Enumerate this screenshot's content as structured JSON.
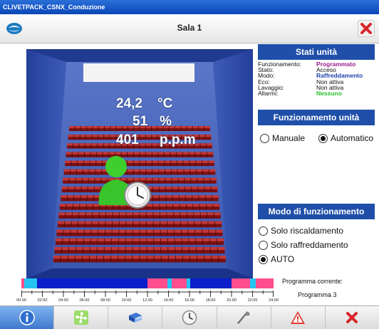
{
  "window": {
    "title": "CLIVETPACK_CSNX_Conduzione"
  },
  "header": {
    "title": "Sala 1"
  },
  "readouts": {
    "temperature": "24,2",
    "temperature_unit": "°C",
    "humidity": "51",
    "humidity_unit": "%",
    "co2": "401",
    "co2_unit": "p.p.m"
  },
  "stati": {
    "header": "Stati unità",
    "rows": [
      {
        "label": "Funzionamento:",
        "value": "Programmato",
        "color": "#9b1a8c"
      },
      {
        "label": "Stato:",
        "value": "Acceso",
        "color": "#111111"
      },
      {
        "label": "Modo:",
        "value": "Raffreddamento",
        "color": "#1b3ea8"
      },
      {
        "label": "Eco:",
        "value": "Non attiva",
        "color": "#111111"
      },
      {
        "label": "Lavaggio:",
        "value": "Non attiva",
        "color": "#111111"
      },
      {
        "label": "Allarmi:",
        "value": "Nessuno",
        "color": "#26c22a"
      }
    ]
  },
  "funzionamento": {
    "header": "Funzionamento unità",
    "options": [
      {
        "label": "Manuale",
        "selected": false
      },
      {
        "label": "Automatico",
        "selected": true
      }
    ]
  },
  "modo": {
    "header": "Modo di funzionamento",
    "options": [
      {
        "label": "Solo riscaldamento",
        "selected": false
      },
      {
        "label": "Solo raffreddamento",
        "selected": false
      },
      {
        "label": "AUTO",
        "selected": true
      }
    ]
  },
  "schedule": {
    "ticks": [
      "00:00",
      "02:00",
      "04:00",
      "06:00",
      "08:00",
      "10:00",
      "12:00",
      "14:00",
      "16:00",
      "18:00",
      "20:00",
      "22:00",
      "24:00"
    ],
    "segments": [
      {
        "start": 0,
        "end": 0.3,
        "color": "#ff4d8d"
      },
      {
        "start": 0.3,
        "end": 1.5,
        "color": "#24c4f2"
      },
      {
        "start": 1.5,
        "end": 12.0,
        "color": "#0a1fc9"
      },
      {
        "start": 12.0,
        "end": 13.9,
        "color": "#ff4d8d"
      },
      {
        "start": 13.9,
        "end": 14.3,
        "color": "#24c4f2"
      },
      {
        "start": 14.3,
        "end": 15.7,
        "color": "#ff4d8d"
      },
      {
        "start": 15.7,
        "end": 16.1,
        "color": "#24c4f2"
      },
      {
        "start": 16.1,
        "end": 20.0,
        "color": "#0a1fc9"
      },
      {
        "start": 20.0,
        "end": 21.8,
        "color": "#ff4d8d"
      },
      {
        "start": 21.8,
        "end": 22.3,
        "color": "#24c4f2"
      },
      {
        "start": 22.3,
        "end": 24.0,
        "color": "#ff4d8d"
      }
    ],
    "program_label": "Programma corrente:",
    "program_value": "Programma 3"
  },
  "toolbar": {
    "buttons": [
      "info-icon",
      "fan-icon",
      "book-icon",
      "clock-icon",
      "wrench-icon",
      "warning-icon",
      "close-icon"
    ]
  }
}
